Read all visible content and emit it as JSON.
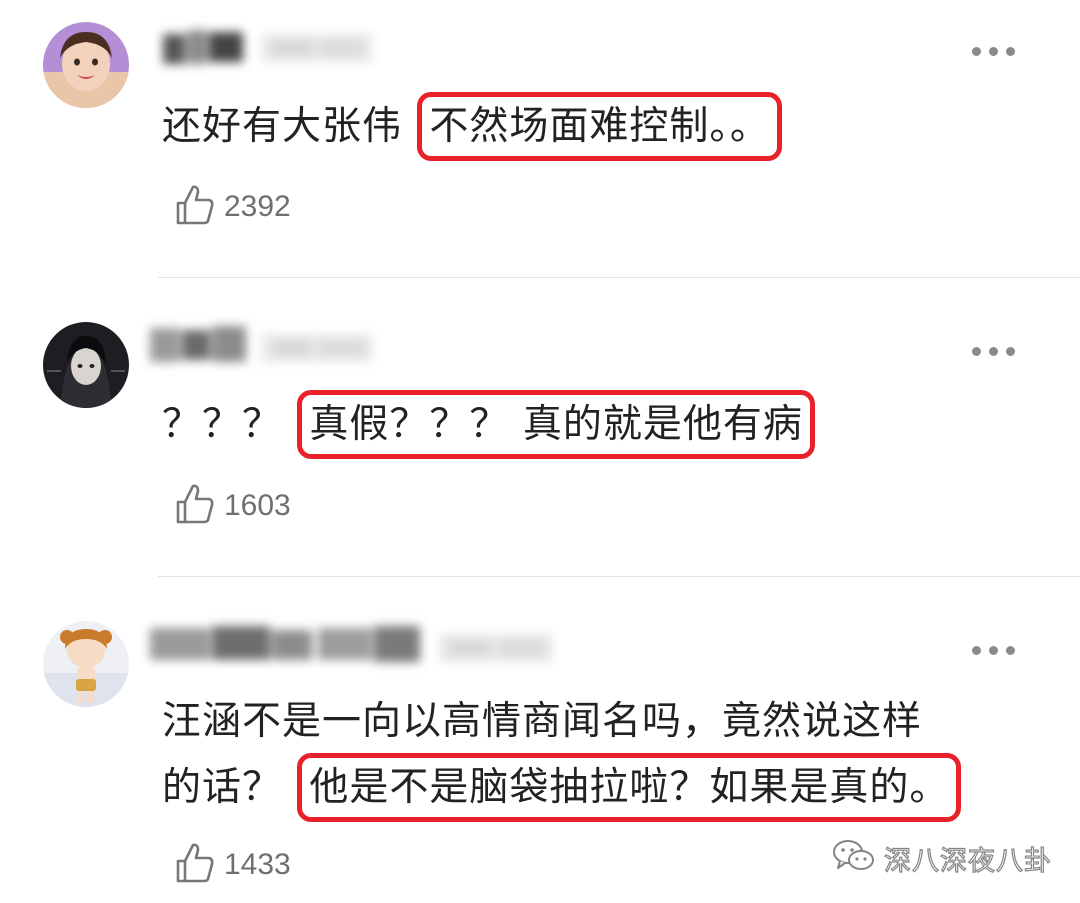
{
  "comments": [
    {
      "username": "",
      "text_plain": "还好有大张伟",
      "text_highlight": "不然场面难控制。。",
      "text_line2_plain": "",
      "text_line2_highlight": "",
      "likes": "2392"
    },
    {
      "username": "",
      "text_plain": "？？？",
      "text_highlight": "真假？？？ 真的就是他有病",
      "text_line2_plain": "",
      "text_line2_highlight": "",
      "likes": "1603"
    },
    {
      "username": "",
      "text_plain": "汪涵不是一向以高情商闻名吗，竟然说这样",
      "text_highlight": "",
      "text_line2_plain": "的话？",
      "text_line2_highlight": "他是不是脑袋抽拉啦？如果是真的。",
      "likes": "1433"
    }
  ],
  "icons": {
    "more": "more-dots-icon",
    "like": "thumbs-up-icon",
    "watermark": "wechat-icon"
  },
  "colors": {
    "highlight_box": "#e8212b",
    "text": "#222222",
    "count": "#6f6f6f",
    "divider": "#e4e4e4"
  },
  "watermark": {
    "text": "深八深夜八卦"
  }
}
